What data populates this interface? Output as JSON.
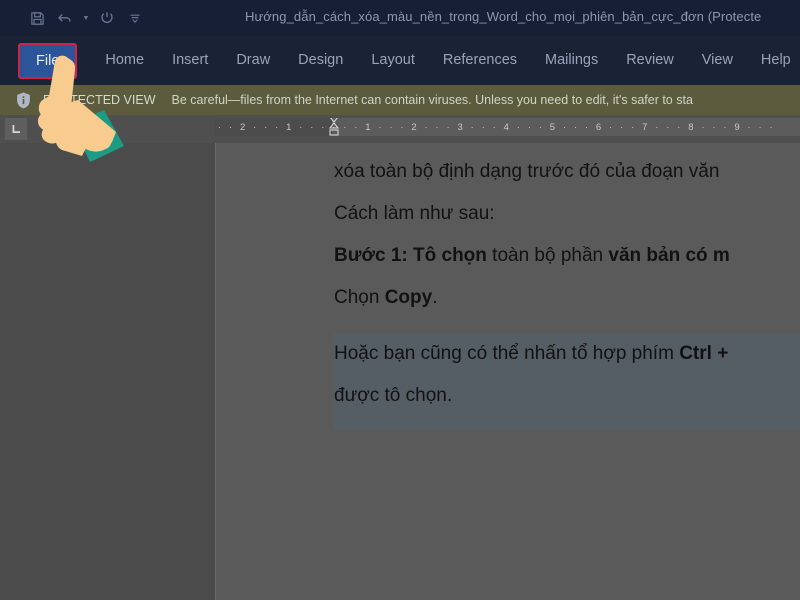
{
  "window": {
    "title": "Hướng_dẫn_cách_xóa_màu_nền_trong_Word_cho_mọi_phiên_bản_cực_đơn (Protecte"
  },
  "quick_access": {
    "save_icon": "save-icon",
    "undo_icon": "undo-icon",
    "undo_caret_icon": "chevron-down-icon",
    "redo_icon": "redo-icon",
    "customize_icon": "customize-quick-access-icon"
  },
  "ribbon": {
    "tabs": [
      {
        "label": "File",
        "active": true
      },
      {
        "label": "Home",
        "active": false
      },
      {
        "label": "Insert",
        "active": false
      },
      {
        "label": "Draw",
        "active": false
      },
      {
        "label": "Design",
        "active": false
      },
      {
        "label": "Layout",
        "active": false
      },
      {
        "label": "References",
        "active": false
      },
      {
        "label": "Mailings",
        "active": false
      },
      {
        "label": "Review",
        "active": false
      },
      {
        "label": "View",
        "active": false
      },
      {
        "label": "Help",
        "active": false
      }
    ],
    "file_highlight_border_color": "#cf2347",
    "file_button_color": "#2c5599"
  },
  "protected_view": {
    "icon": "info-shield-icon",
    "label": "PROTECTED VIEW",
    "message": "Be careful—files from the Internet can contain viruses. Unless you need to edit, it's safer to sta",
    "bar_color": "#5d5b3e"
  },
  "ruler": {
    "tabstop_icon": "left-tab-stop-icon",
    "ticks": "·  ·  2  ·  ·  ·  1  ·  ·  ·      ·  ·  ·  1  ·  ·  ·  2  ·  ·  ·  3  ·  ·  ·  4  ·  ·  ·  5  ·  ·  ·  6  ·  ·  ·  7  ·  ·  ·  8  ·  ·  ·  9  ·  ·  ·",
    "indent_marker_icon": "indent-marker-icon"
  },
  "document": {
    "paragraphs": [
      {
        "name": "paragraph-line-1",
        "runs": [
          {
            "text": "xóa toàn bộ định dạng trước đó của đoạn văn ",
            "bold": false
          }
        ],
        "selected": false
      },
      {
        "name": "paragraph-cach-lam",
        "runs": [
          {
            "text": "Cách làm như sau:",
            "bold": false
          }
        ],
        "selected": false
      },
      {
        "name": "paragraph-buoc-1",
        "runs": [
          {
            "text": "Bước 1: Tô chọn",
            "bold": true
          },
          {
            "text": " toàn bộ phần ",
            "bold": false
          },
          {
            "text": "văn bản có m",
            "bold": true
          }
        ],
        "selected": false
      },
      {
        "name": "paragraph-chon-copy",
        "runs": [
          {
            "text": "Chọn ",
            "bold": false
          },
          {
            "text": "Copy",
            "bold": true
          },
          {
            "text": ".",
            "bold": false
          }
        ],
        "selected": false
      },
      {
        "name": "paragraph-hoac-ban",
        "runs": [
          {
            "text": "Hoặc bạn cũng có thể nhấn tổ hợp phím ",
            "bold": false
          },
          {
            "text": "Ctrl +",
            "bold": true
          }
        ],
        "selected": true
      },
      {
        "name": "paragraph-duoc-to-chon",
        "runs": [
          {
            "text": "được tô chọn.",
            "bold": false
          }
        ],
        "selected": true
      }
    ],
    "page_background_color": "#5a5a5a",
    "selection_color": "#555e64"
  },
  "cursor": {
    "icon": "pointing-hand-cursor",
    "skin_color": "#f7cc8e",
    "sleeve_color": "#1c9c85",
    "cuff_dot_color": "#bfe6e0"
  }
}
